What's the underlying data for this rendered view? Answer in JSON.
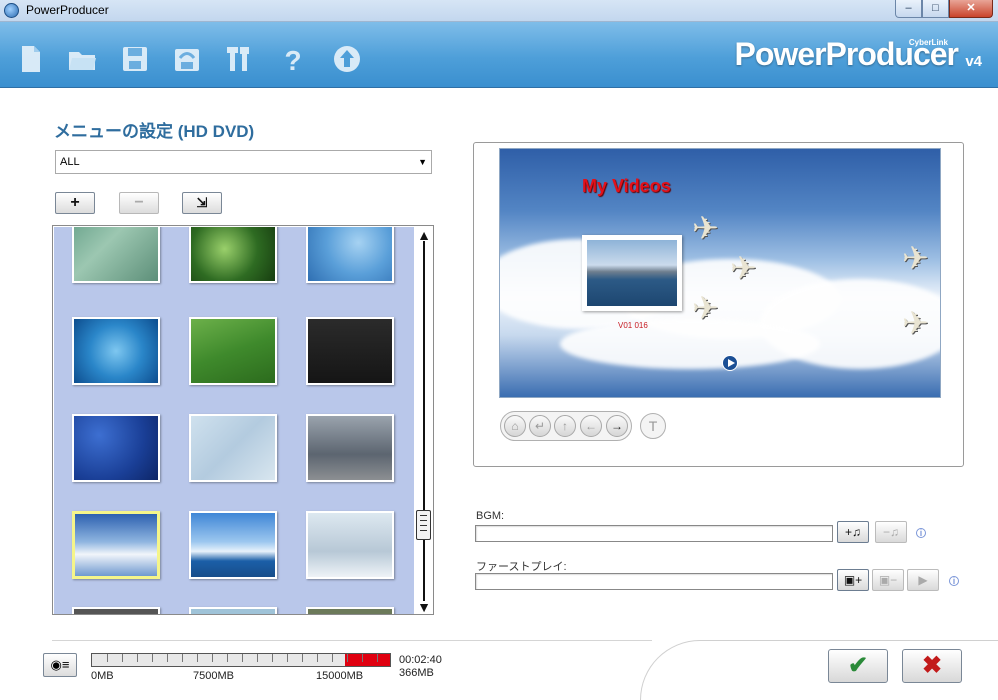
{
  "window": {
    "title": "PowerProducer"
  },
  "toolbar": {
    "icons": [
      "new-project-icon",
      "open-folder-icon",
      "save-icon",
      "save-as-icon",
      "tools-icon",
      "help-icon",
      "upgrade-icon"
    ],
    "brand": "PowerProducer",
    "brand_small": "CyberLink",
    "brand_version": "v4"
  },
  "menu_settings": {
    "title": "メニューの設定 (HD DVD)",
    "filter_value": "ALL",
    "add_label": "+",
    "remove_label": "−",
    "import_label": "⇲"
  },
  "templates": [
    "green-pattern",
    "leaves",
    "runner",
    "water",
    "soccer",
    "dark-film",
    "basketball",
    "map-sea",
    "eiffel",
    "clouds-planes",
    "sea-sky",
    "snowman",
    "partial-1",
    "partial-2",
    "partial-3"
  ],
  "selected_template": "clouds-planes",
  "preview": {
    "menu_title": "My Videos",
    "chapter_caption": "V01 016",
    "nav_buttons": [
      "⌂",
      "↵",
      "↑",
      "←",
      "→"
    ],
    "text_button": "T"
  },
  "bgm": {
    "label": "BGM:",
    "value": "",
    "add_icon": "+♫",
    "remove_icon": "−♫"
  },
  "first_play": {
    "label": "ファーストプレイ:",
    "value": "",
    "add_icon": "▣+",
    "remove_icon": "▣−",
    "play_icon": "▶"
  },
  "info_icon": "i",
  "capacity": {
    "labels": [
      "0MB",
      "7500MB",
      "15000MB"
    ],
    "duration": "00:02:40",
    "size": "366MB",
    "used_fraction": 0.15
  },
  "colors": {
    "toolbar": "#4e9fd9",
    "brand_blue": "#2f6d9e",
    "capacity_fill": "#e00010",
    "ok": "#2a8a39",
    "cancel": "#c21a1a"
  },
  "actions": {
    "ok_icon": "✔",
    "cancel_icon": "✖"
  },
  "window_buttons": {
    "minimize": "–",
    "maximize": "□",
    "close": "✕"
  }
}
